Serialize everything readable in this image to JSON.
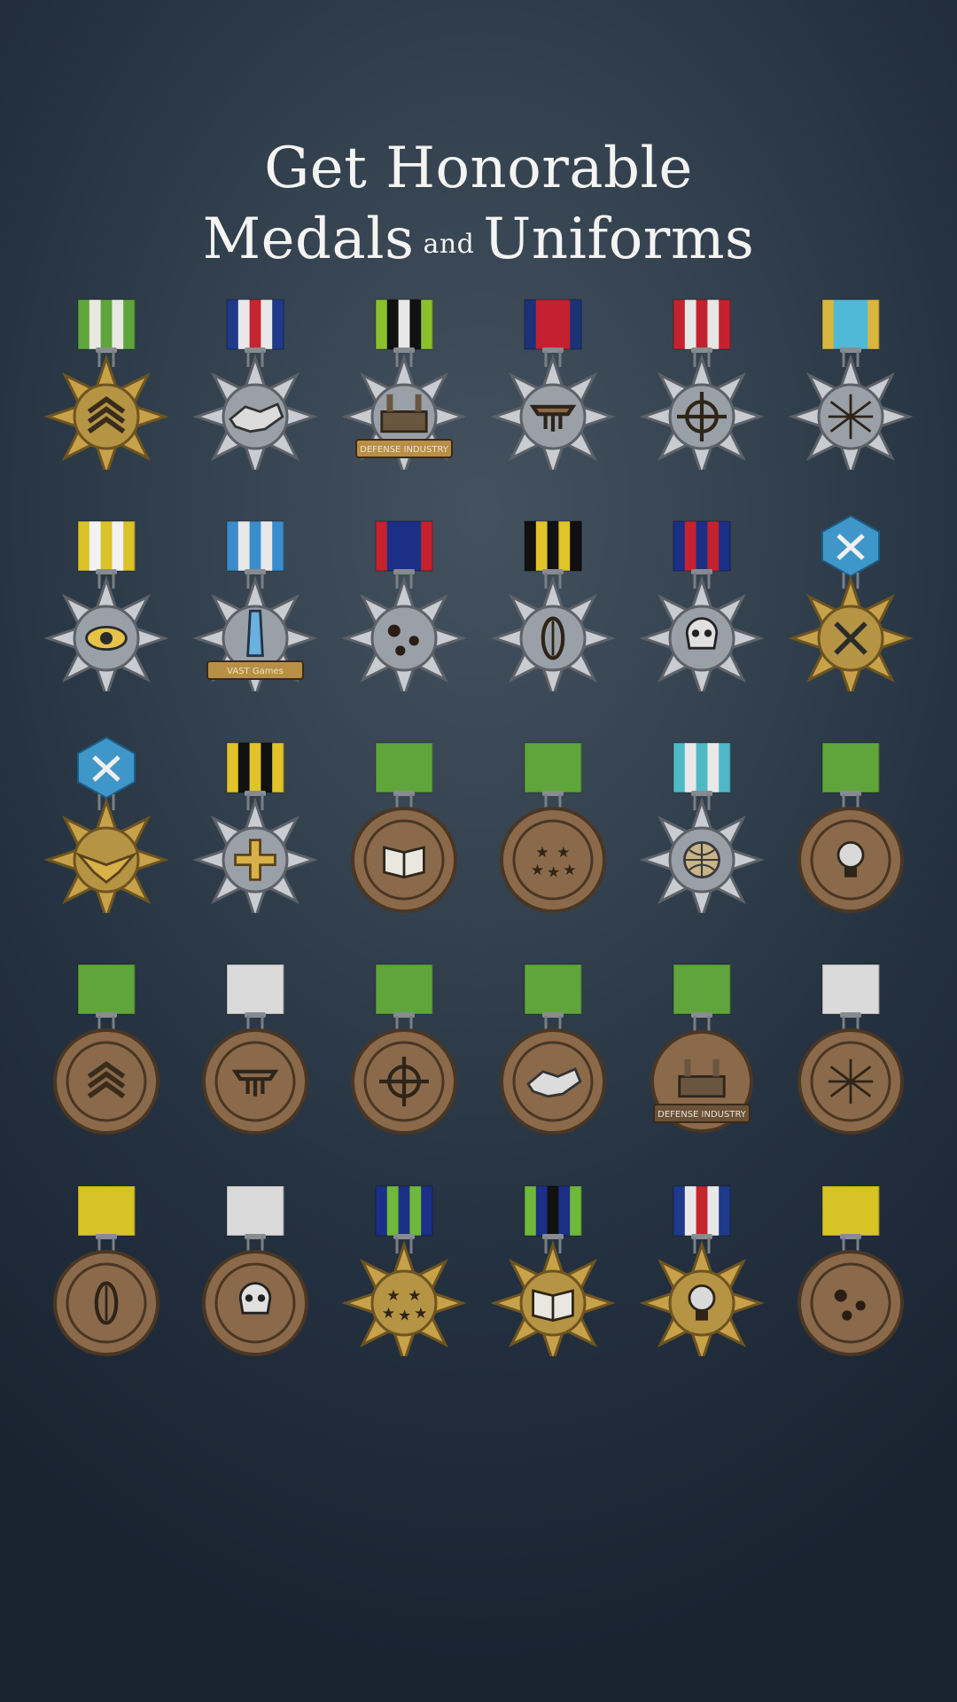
{
  "title": {
    "part1": "Get Honorable Medals",
    "part2": "and",
    "part3": "Uniforms"
  },
  "colors": {
    "bronze": "#8a6a4a",
    "silver": "#c9ccd0",
    "gold": "#c8a24a",
    "ribbon_green": "#5fa53c",
    "ribbon_white": "#e2e2e2",
    "ribbon_yellow": "#d4c12a",
    "hex_blue": "#3f97c9"
  },
  "medals": [
    {
      "name": "medal-chevron-star",
      "ribbon": "green-stripes",
      "icon": "chevron-icon"
    },
    {
      "name": "medal-handshake-silver",
      "ribbon": "flag",
      "icon": "handshake-icon"
    },
    {
      "name": "medal-defense-industry",
      "ribbon": "black-white-lime",
      "icon": "factory-icon",
      "banner": "DEFENSE INDUSTRY"
    },
    {
      "name": "medal-cross-tank",
      "ribbon": "blue-red",
      "icon": "tank-icon"
    },
    {
      "name": "medal-cross-crosshair",
      "ribbon": "red-white",
      "icon": "crosshair-icon"
    },
    {
      "name": "medal-cross-burst",
      "ribbon": "gold-cyan",
      "icon": "burst-icon"
    },
    {
      "name": "medal-eye-cross",
      "ribbon": "yellow-white",
      "icon": "eye-icon"
    },
    {
      "name": "medal-vast-games",
      "ribbon": "blue",
      "icon": "rocket-icon",
      "banner": "VAST Games"
    },
    {
      "name": "medal-bullet-holes",
      "ribbon": "navy-red",
      "icon": "bullet-holes-icon"
    },
    {
      "name": "medal-bomb",
      "ribbon": "black-yellow",
      "icon": "bomb-icon"
    },
    {
      "name": "medal-skull",
      "ribbon": "navy-red-stripes",
      "icon": "skull-icon"
    },
    {
      "name": "medal-gold-emblem",
      "ribbon": "hex-blue",
      "icon": "crossed-swords-icon"
    },
    {
      "name": "medal-eagle",
      "ribbon": "hex-blue",
      "icon": "eagle-icon"
    },
    {
      "name": "medal-star-cross",
      "ribbon": "yellow-black",
      "icon": "cross-icon"
    },
    {
      "name": "medal-book",
      "ribbon": "green",
      "icon": "book-icon"
    },
    {
      "name": "medal-five-stars",
      "ribbon": "green",
      "icon": "stars-icon"
    },
    {
      "name": "medal-globe",
      "ribbon": "teal-white",
      "icon": "globe-icon"
    },
    {
      "name": "medal-lightbulb",
      "ribbon": "green",
      "icon": "lightbulb-icon"
    },
    {
      "name": "medal-chevron-bronze",
      "ribbon": "green",
      "icon": "chevron-icon"
    },
    {
      "name": "medal-tank-bronze",
      "ribbon": "white",
      "icon": "tank-icon"
    },
    {
      "name": "medal-crosshair-bronze",
      "ribbon": "green",
      "icon": "crosshair-icon"
    },
    {
      "name": "medal-handshake-bronze",
      "ribbon": "green",
      "icon": "handshake-icon"
    },
    {
      "name": "medal-defense-bronze",
      "ribbon": "green",
      "icon": "factory-icon",
      "banner": "DEFENSE INDUSTRY"
    },
    {
      "name": "medal-burst-bronze",
      "ribbon": "white",
      "icon": "burst-icon"
    },
    {
      "name": "medal-bomb-bronze",
      "ribbon": "yellow",
      "icon": "bomb-icon"
    },
    {
      "name": "medal-skull-bronze",
      "ribbon": "white",
      "icon": "skull-icon"
    },
    {
      "name": "medal-stars-gold",
      "ribbon": "navy-lime",
      "icon": "stars-icon"
    },
    {
      "name": "medal-book-gold",
      "ribbon": "lime-navy",
      "icon": "book-icon"
    },
    {
      "name": "medal-lightbulb-gold",
      "ribbon": "flag",
      "icon": "lightbulb-icon"
    },
    {
      "name": "medal-bullet-bronze",
      "ribbon": "yellow",
      "icon": "bullet-holes-icon"
    }
  ]
}
